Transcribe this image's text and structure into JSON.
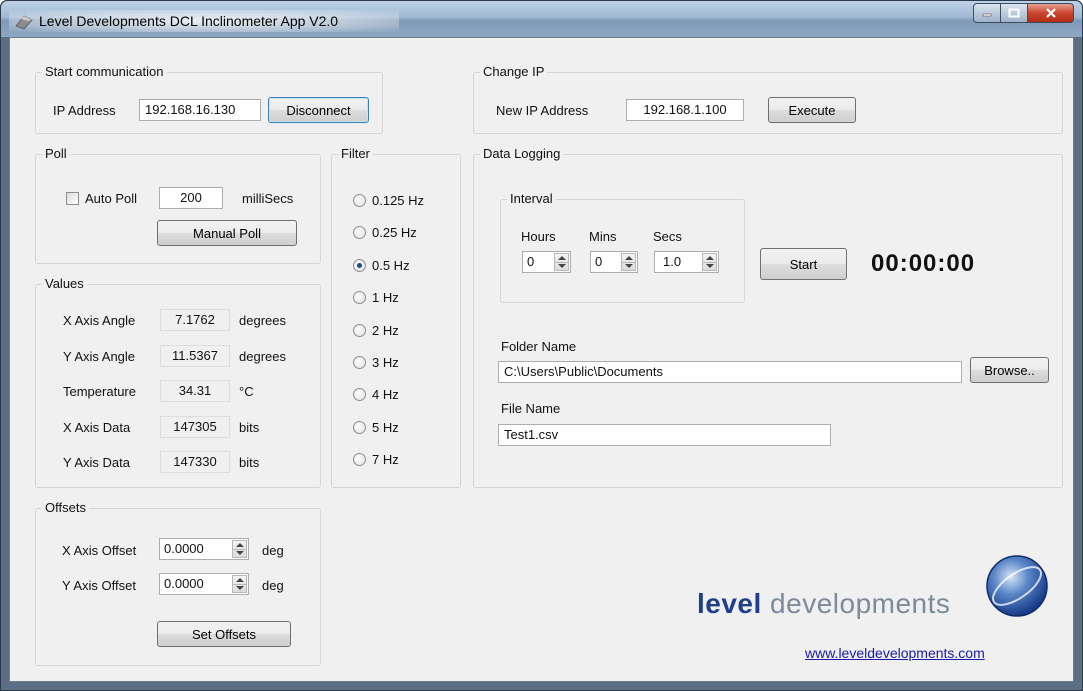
{
  "window": {
    "title": "Level Developments DCL Inclinometer App V2.0"
  },
  "start_communication": {
    "legend": "Start communication",
    "ip_label": "IP Address",
    "ip_value": "192.168.16.130",
    "disconnect_label": "Disconnect"
  },
  "change_ip": {
    "legend": "Change IP",
    "new_ip_label": "New IP Address",
    "new_ip_value": "192.168.1.100",
    "execute_label": "Execute"
  },
  "poll": {
    "legend": "Poll",
    "auto_poll_label": "Auto Poll",
    "auto_poll_checked": false,
    "interval_value": "200",
    "interval_unit": "milliSecs",
    "manual_poll_label": "Manual Poll"
  },
  "filter": {
    "legend": "Filter",
    "options": [
      "0.125 Hz",
      "0.25 Hz",
      "0.5 Hz",
      "1 Hz",
      "2 Hz",
      "3 Hz",
      "4 Hz",
      "5 Hz",
      "7 Hz"
    ],
    "selected": "0.5 Hz"
  },
  "values": {
    "legend": "Values",
    "rows": [
      {
        "label": "X Axis Angle",
        "value": "7.1762",
        "unit": "degrees"
      },
      {
        "label": "Y Axis Angle",
        "value": "11.5367",
        "unit": "degrees"
      },
      {
        "label": "Temperature",
        "value": "34.31",
        "unit": "°C"
      },
      {
        "label": "X Axis Data",
        "value": "147305",
        "unit": "bits"
      },
      {
        "label": "Y Axis Data",
        "value": "147330",
        "unit": "bits"
      }
    ]
  },
  "offsets": {
    "legend": "Offsets",
    "x_label": "X Axis Offset",
    "x_value": "0.0000",
    "y_label": "Y Axis Offset",
    "y_value": "0.0000",
    "unit": "deg",
    "set_label": "Set Offsets"
  },
  "data_logging": {
    "legend": "Data Logging",
    "interval": {
      "legend": "Interval",
      "hours_label": "Hours",
      "hours_value": "0",
      "mins_label": "Mins",
      "mins_value": "0",
      "secs_label": "Secs",
      "secs_value": "1.0"
    },
    "start_label": "Start",
    "timer": "00:00:00",
    "folder_label": "Folder Name",
    "folder_value": "C:\\Users\\Public\\Documents",
    "browse_label": "Browse..",
    "file_label": "File Name",
    "file_value": "Test1.csv"
  },
  "branding": {
    "logo_bold": "level",
    "logo_light": " developments",
    "website": "www.leveldevelopments.com"
  },
  "colors": {
    "logo_blue": "#1f3f8e",
    "logo_grey": "#7d8a99",
    "link": "#1a1aa8"
  }
}
